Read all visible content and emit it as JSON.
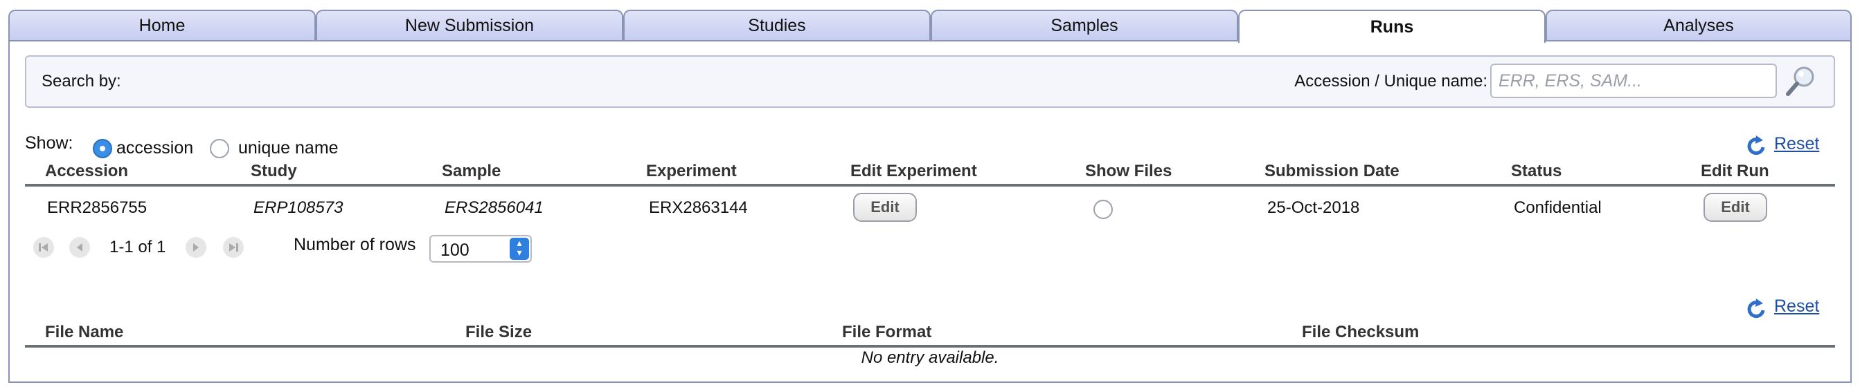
{
  "tabs": [
    {
      "label": "Home",
      "active": false
    },
    {
      "label": "New Submission",
      "active": false
    },
    {
      "label": "Studies",
      "active": false
    },
    {
      "label": "Samples",
      "active": false
    },
    {
      "label": "Runs",
      "active": true
    },
    {
      "label": "Analyses",
      "active": false
    }
  ],
  "search": {
    "title": "Search by:",
    "accession_label": "Accession / Unique name:",
    "placeholder": "ERR, ERS, SAM...",
    "value": "",
    "icon": "magnifier-icon"
  },
  "show": {
    "label": "Show:",
    "options": [
      {
        "label": "accession",
        "selected": true
      },
      {
        "label": "unique name",
        "selected": false
      }
    ]
  },
  "runs_table": {
    "reset_label": "Reset",
    "columns": [
      "Accession",
      "Study",
      "Sample",
      "Experiment",
      "Edit Experiment",
      "Show Files",
      "Submission Date",
      "Status",
      "Edit Run"
    ],
    "rows": [
      {
        "accession": "ERR2856755",
        "study": "ERP108573",
        "sample": "ERS2856041",
        "experiment": "ERX2863144",
        "edit_experiment_label": "Edit",
        "show_files_selected": false,
        "submission_date": "25-Oct-2018",
        "status": "Confidential",
        "edit_run_label": "Edit"
      }
    ],
    "pager": {
      "range_text": "1-1 of 1",
      "rows_label": "Number of rows",
      "rows_value": "100"
    }
  },
  "files_table": {
    "reset_label": "Reset",
    "columns": [
      "File Name",
      "File Size",
      "File Format",
      "File Checksum"
    ],
    "empty_message": "No entry available."
  },
  "colors": {
    "tab_bg": "#c6cdf0",
    "border": "#8a94b4",
    "link": "#1f4fa1",
    "radio_selected": "#3a8ee6",
    "select_arrow": "#2f7fe0"
  }
}
